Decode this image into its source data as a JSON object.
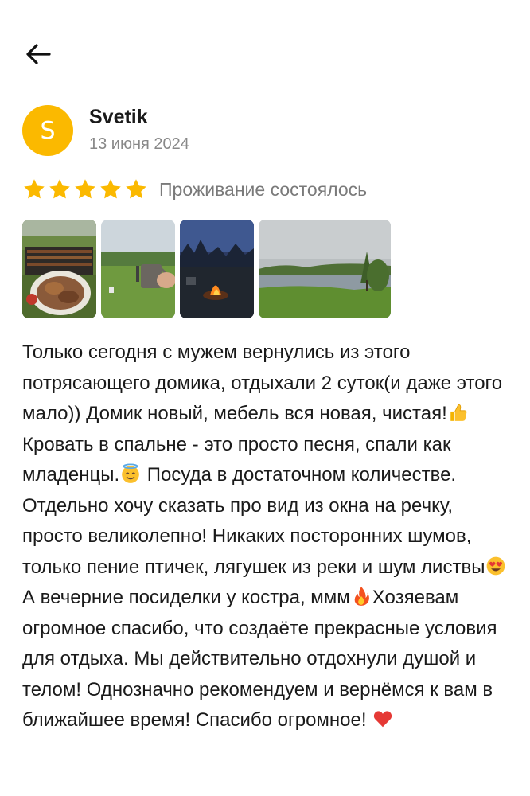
{
  "nav": {
    "back_icon": "arrow-left-icon"
  },
  "author": {
    "avatar_initial": "S",
    "avatar_color": "#fbb900",
    "name": "Svetik",
    "date": "13 июня 2024"
  },
  "rating": {
    "stars": 5,
    "max": 5,
    "star_color": "#fbb900",
    "status": "Проживание состоялось"
  },
  "photos": [
    {
      "icon": "photo-grill-thumbnail"
    },
    {
      "icon": "photo-meadow-mug-thumbnail"
    },
    {
      "icon": "photo-bonfire-thumbnail"
    },
    {
      "icon": "photo-river-landscape-thumbnail"
    }
  ],
  "review": {
    "part1": "Только сегодня с мужем вернулись  из этого потрясающего домика, отдыхали 2 суток(и даже этого мало)) Домик новый, мебель вся новая, чистая!",
    "part2": " Кровать в спальне - это просто песня, спали как младенцы.",
    "part3": " Посуда в достаточном количестве. Отдельно хочу сказать про вид из окна на речку, просто великолепно! Никаких посторонних шумов, только пение птичек, лягушек из реки и шум листвы",
    "part4": " А вечерние посиделки у костра, ммм",
    "part5": "Хозяевам огромное спасибо, что создаёте прекрасные условия для отдыха. Мы действительно отдохнули душой и телом! Однозначно рекомендуем и вернёмся к вам в ближайшее время! Спасибо огромное! ",
    "emojis": [
      "thumbs-up-icon",
      "angel-smile-icon",
      "heart-eyes-icon",
      "fire-icon",
      "red-heart-icon"
    ]
  }
}
